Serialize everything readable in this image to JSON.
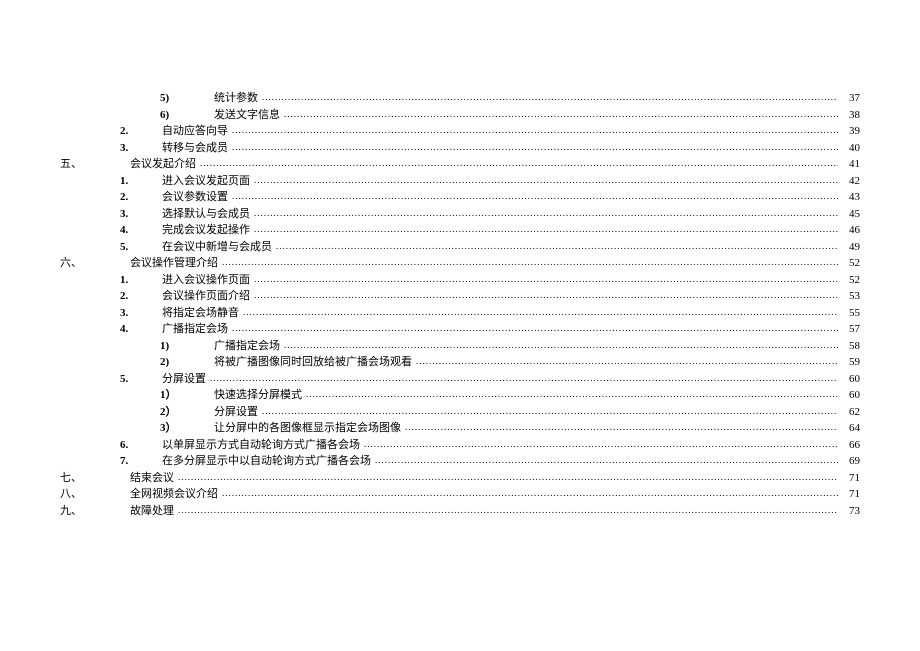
{
  "toc": [
    {
      "level": 3,
      "section": "",
      "num": "5)",
      "title": "统计参数",
      "page": "37"
    },
    {
      "level": 3,
      "section": "",
      "num": "6)",
      "title": "发送文字信息",
      "page": "38"
    },
    {
      "level": 2,
      "section": "",
      "num": "2.",
      "title": "自动应答向导",
      "page": "39"
    },
    {
      "level": 2,
      "section": "",
      "num": "3.",
      "title": "转移与会成员",
      "page": "40"
    },
    {
      "level": 1,
      "section": "五、",
      "num": "",
      "title": "会议发起介绍",
      "page": "41"
    },
    {
      "level": 2,
      "section": "",
      "num": "1.",
      "title": "进入会议发起页面",
      "page": "42"
    },
    {
      "level": 2,
      "section": "",
      "num": "2.",
      "title": "会议参数设置",
      "page": "43"
    },
    {
      "level": 2,
      "section": "",
      "num": "3.",
      "title": "选择默认与会成员",
      "page": "45"
    },
    {
      "level": 2,
      "section": "",
      "num": "4.",
      "title": "完成会议发起操作",
      "page": "46"
    },
    {
      "level": 2,
      "section": "",
      "num": "5.",
      "title": "在会议中新增与会成员",
      "page": "49"
    },
    {
      "level": 1,
      "section": "六、",
      "num": "",
      "title": "会议操作管理介绍",
      "page": "52"
    },
    {
      "level": 2,
      "section": "",
      "num": "1.",
      "title": "进入会议操作页面",
      "page": "52"
    },
    {
      "level": 2,
      "section": "",
      "num": "2.",
      "title": "会议操作页面介绍",
      "page": "53"
    },
    {
      "level": 2,
      "section": "",
      "num": "3.",
      "title": "将指定会场静音",
      "page": "55"
    },
    {
      "level": 2,
      "section": "",
      "num": "4.",
      "title": "广播指定会场",
      "page": "57"
    },
    {
      "level": 3,
      "section": "",
      "num": "1)",
      "title": "广播指定会场",
      "page": "58"
    },
    {
      "level": 3,
      "section": "",
      "num": "2)",
      "title": "将被广播图像同时回放给被广播会场观看",
      "page": "59"
    },
    {
      "level": 2,
      "section": "",
      "num": "5.",
      "title": "分屏设置",
      "page": "60"
    },
    {
      "level": 3,
      "section": "",
      "num": "1）",
      "title": "快速选择分屏模式",
      "page": "60"
    },
    {
      "level": 3,
      "section": "",
      "num": "2）",
      "title": "分屏设置",
      "page": "62"
    },
    {
      "level": 3,
      "section": "",
      "num": "3）",
      "title": "让分屏中的各图像框显示指定会场图像",
      "page": "64"
    },
    {
      "level": 2,
      "section": "",
      "num": "6.",
      "title": "以单屏显示方式自动轮询方式广播各会场",
      "page": "66"
    },
    {
      "level": 2,
      "section": "",
      "num": "7.",
      "title": "在多分屏显示中以自动轮询方式广播各会场",
      "page": "69"
    },
    {
      "level": 1,
      "section": "七、",
      "num": "",
      "title": "结束会议",
      "page": "71"
    },
    {
      "level": 1,
      "section": "八、",
      "num": "",
      "title": "全网视频会议介绍",
      "page": "71"
    },
    {
      "level": 1,
      "section": "九、",
      "num": "",
      "title": "故障处理",
      "page": "73"
    }
  ]
}
